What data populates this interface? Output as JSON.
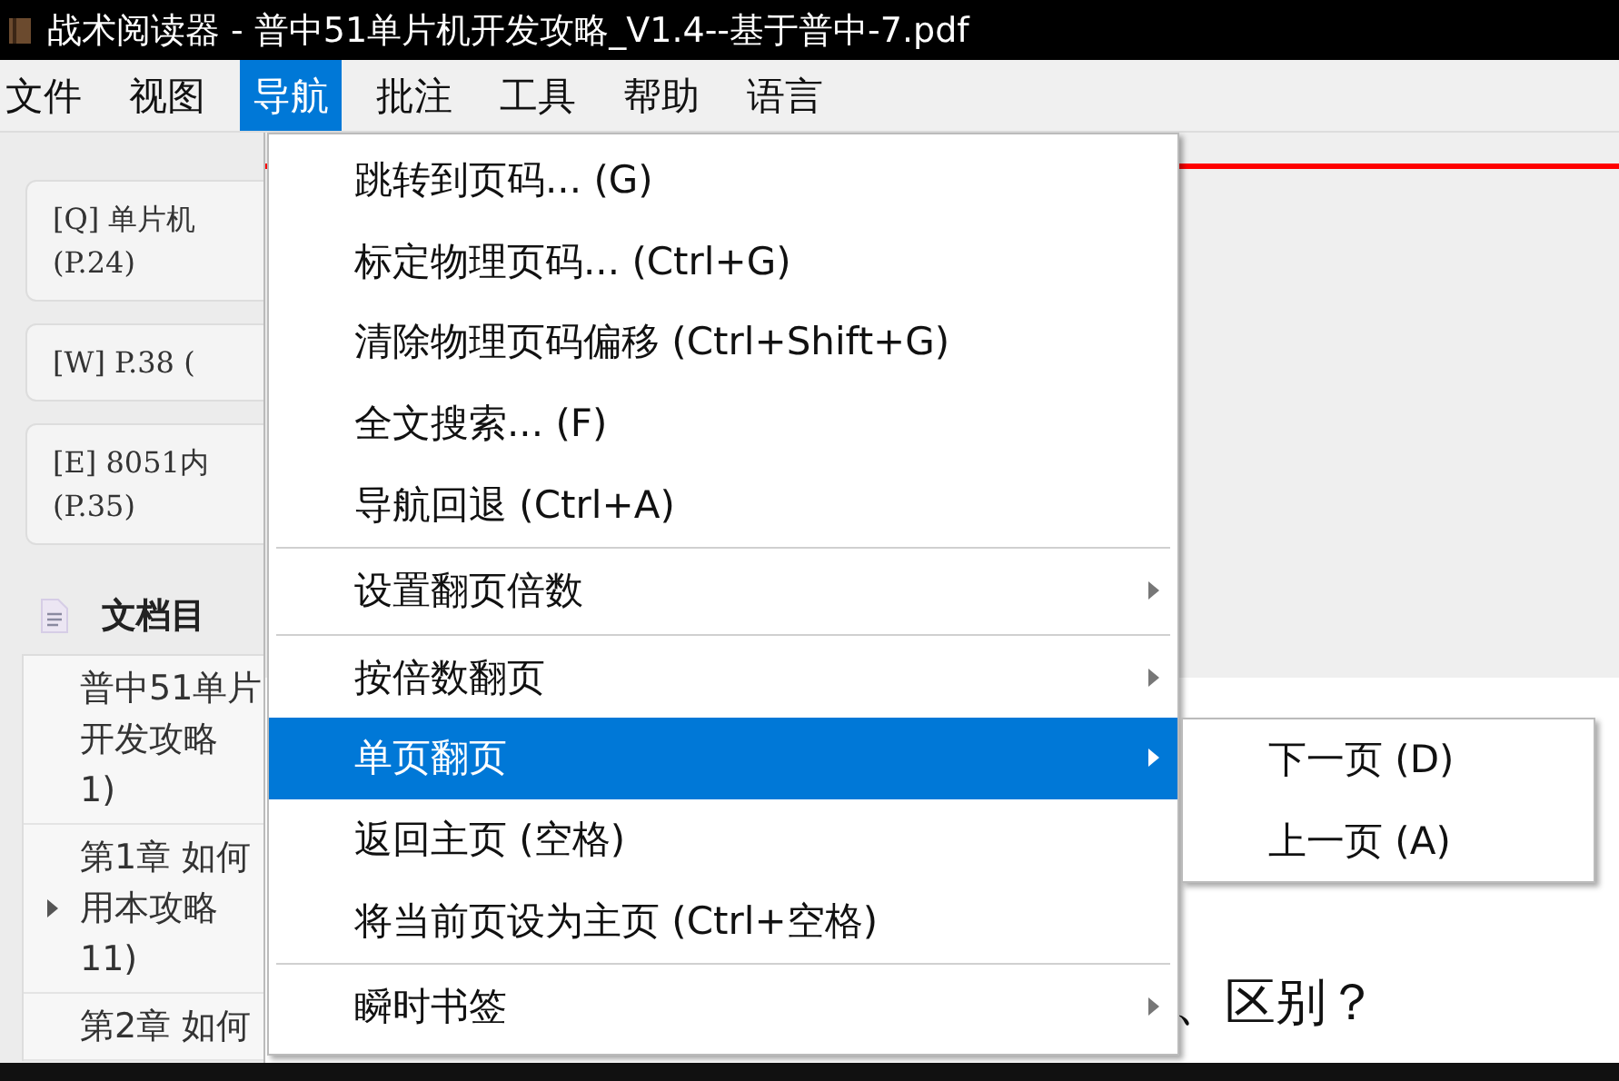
{
  "window": {
    "title": "战术阅读器 - 普中51单片机开发攻略_V1.4--基于普中-7.pdf"
  },
  "menu_bar": [
    {
      "label": "文件",
      "selected": false
    },
    {
      "label": "视图",
      "selected": false
    },
    {
      "label": "导航",
      "selected": true
    },
    {
      "label": "批注",
      "selected": false
    },
    {
      "label": "工具",
      "selected": false
    },
    {
      "label": "帮助",
      "selected": false
    },
    {
      "label": "语言",
      "selected": false
    }
  ],
  "sidebar": {
    "bookmarks": [
      {
        "lines": [
          "[Q] 单片机",
          "(P.24)"
        ]
      },
      {
        "lines": [
          "[W] P.38 ("
        ]
      },
      {
        "lines": [
          "[E] 8051内",
          "(P.35)"
        ]
      }
    ],
    "toc_title": "文档目",
    "toc": [
      {
        "kind": "leaf",
        "lines": [
          "普中51单片",
          "开发攻略",
          "1)"
        ]
      },
      {
        "kind": "branch",
        "expanded": false,
        "lines": [
          "第1章 如何",
          "用本攻略",
          "11)"
        ]
      },
      {
        "kind": "leaf",
        "lines": [
          "第2章 如何"
        ]
      }
    ]
  },
  "document": {
    "heading": "、区别？"
  },
  "menu": [
    {
      "kind": "item",
      "label": "跳转到页码... (G)",
      "selected": false
    },
    {
      "kind": "item",
      "label": "标定物理页码... (Ctrl+G)",
      "selected": false
    },
    {
      "kind": "item",
      "label": "清除物理页码偏移 (Ctrl+Shift+G)",
      "selected": false
    },
    {
      "kind": "item",
      "label": "全文搜索... (F)",
      "selected": false
    },
    {
      "kind": "item",
      "label": "导航回退 (Ctrl+A)",
      "selected": false
    },
    {
      "kind": "separator"
    },
    {
      "kind": "submenu",
      "label": "设置翻页倍数",
      "selected": false
    },
    {
      "kind": "separator"
    },
    {
      "kind": "submenu",
      "label": "按倍数翻页",
      "selected": false
    },
    {
      "kind": "submenu",
      "label": "单页翻页",
      "selected": true
    },
    {
      "kind": "item",
      "label": "返回主页 (空格)",
      "selected": false
    },
    {
      "kind": "item",
      "label": "将当前页设为主页 (Ctrl+空格)",
      "selected": false
    },
    {
      "kind": "separator"
    },
    {
      "kind": "submenu",
      "label": "瞬时书签",
      "selected": false
    }
  ],
  "submenu": [
    {
      "label": "下一页 (D)",
      "selected": false
    },
    {
      "label": "上一页 (A)",
      "selected": false
    }
  ]
}
